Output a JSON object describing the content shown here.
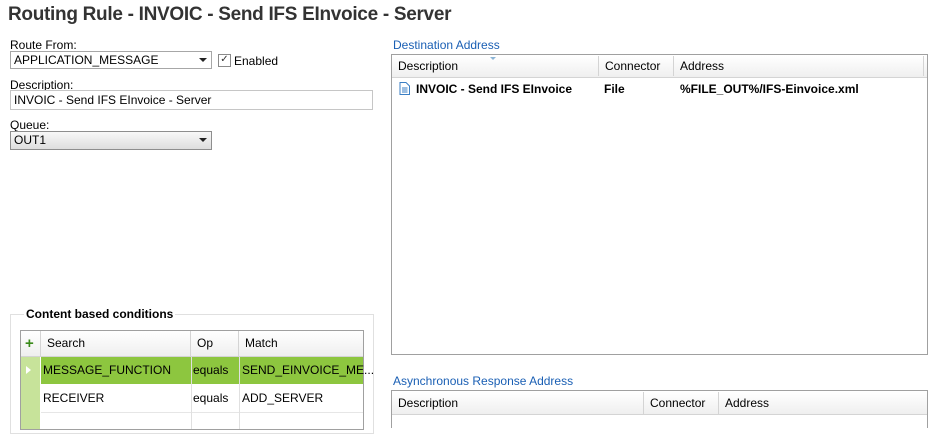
{
  "window": {
    "title": "Routing Rule - INVOIC - Send IFS EInvoice - Server"
  },
  "form": {
    "route_from_label": "Route From:",
    "route_from_value": "APPLICATION_MESSAGE",
    "enabled_label": "Enabled",
    "enabled_checked": true,
    "description_label": "Description:",
    "description_value": "INVOIC - Send IFS EInvoice - Server",
    "queue_label": "Queue:",
    "queue_value": "OUT1"
  },
  "conditions": {
    "title": "Content based conditions",
    "add_icon": "plus-icon",
    "columns": [
      "Search",
      "Op",
      "Match"
    ],
    "rows": [
      {
        "search": "MESSAGE_FUNCTION",
        "op": "equals",
        "match": "SEND_EINVOICE_ME...",
        "selected": true
      },
      {
        "search": "RECEIVER",
        "op": "equals",
        "match": "ADD_SERVER",
        "selected": false
      }
    ],
    "selection_color": "#8dc63f"
  },
  "destination": {
    "title": "Destination Address",
    "columns": [
      "Description",
      "Connector",
      "Address"
    ],
    "rows": [
      {
        "icon": "document-icon",
        "description": "INVOIC - Send IFS EInvoice",
        "connector": "File",
        "address": "%FILE_OUT%/IFS-Einvoice.xml"
      }
    ]
  },
  "async": {
    "title": "Asynchronous Response Address",
    "columns": [
      "Description",
      "Connector",
      "Address"
    ]
  }
}
